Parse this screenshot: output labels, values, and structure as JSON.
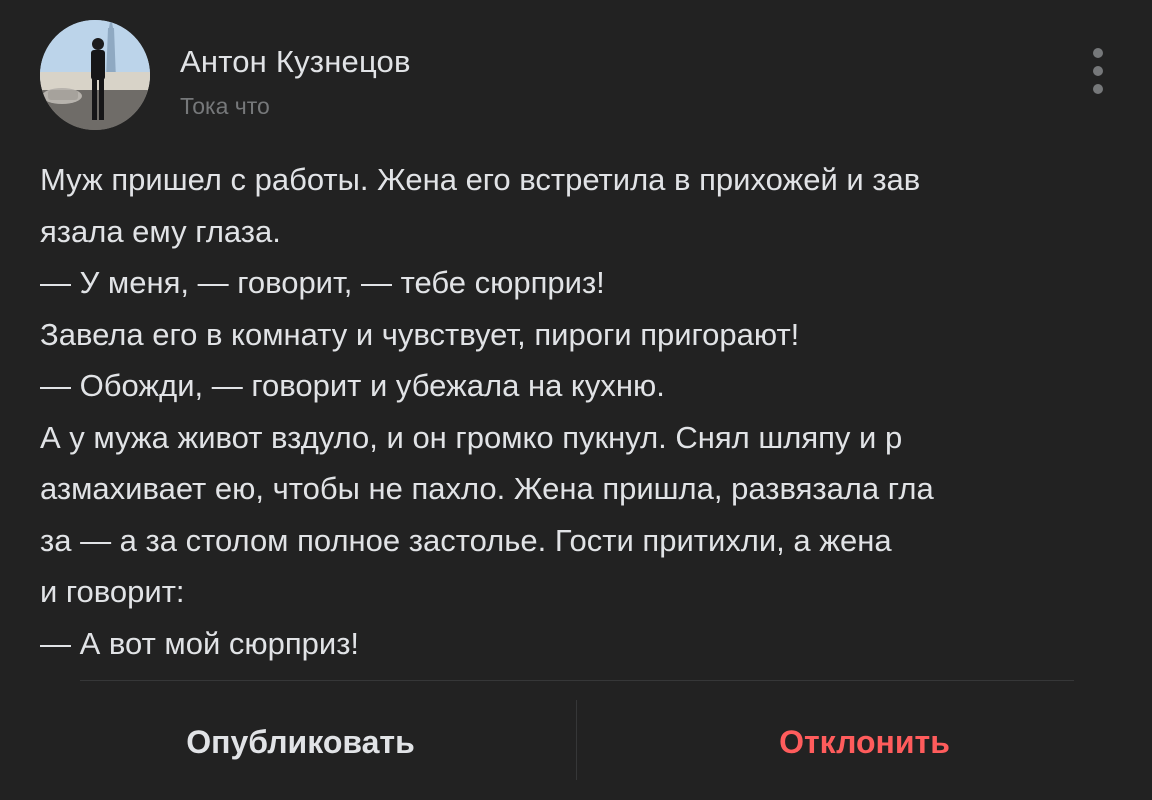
{
  "post": {
    "author": {
      "name": "Антон Кузнецов",
      "time": "Тока что",
      "avatar_icon": "user-avatar-photo"
    },
    "more_icon": "vertical-dots-icon",
    "text_lines": [
      "Муж пришел с работы. Жена его встретила в прихожей и зав",
      "язала ему глаза.",
      "— У меня, — говорит, — тебе сюрприз!",
      "Завела его в комнату и чувствует, пироги пригорают!",
      "— Обожди, — говорит и убежала на кухню.",
      "А у мужа живот вздуло, и он громко пукнул. Снял шляпу и р",
      "азмахивает ею, чтобы не пахло. Жена пришла, развязала гла",
      "за — а за столом полное застолье. Гости притихли, а жена",
      "и говорит:",
      "— А вот мой сюрприз!"
    ]
  },
  "actions": {
    "publish_label": "Опубликовать",
    "decline_label": "Отклонить"
  },
  "colors": {
    "background": "#222222",
    "text_primary": "#e1e3e6",
    "text_secondary": "#76787a",
    "decline": "#ff5c5c"
  }
}
